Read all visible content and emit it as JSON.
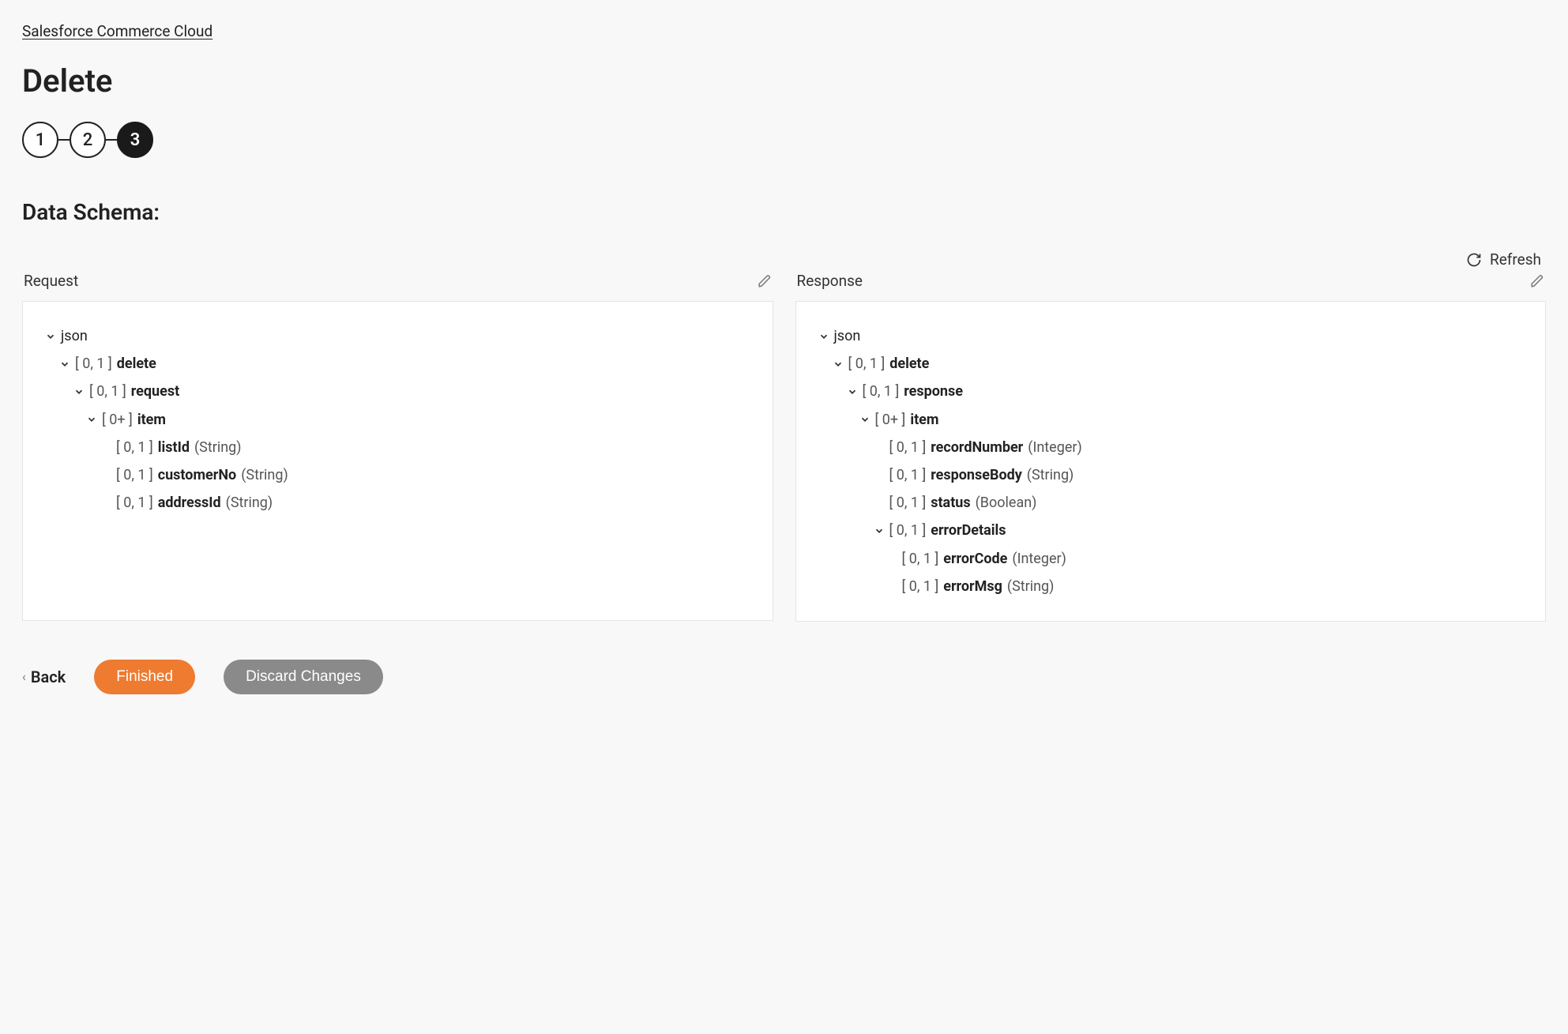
{
  "breadcrumb": "Salesforce Commerce Cloud",
  "page_title": "Delete",
  "stepper": {
    "steps": [
      "1",
      "2",
      "3"
    ],
    "active_index": 2
  },
  "section_title": "Data Schema:",
  "refresh_label": "Refresh",
  "columns": {
    "request": {
      "title": "Request",
      "tree": [
        {
          "indent": 0,
          "expandable": true,
          "text_plain": "json"
        },
        {
          "indent": 1,
          "expandable": true,
          "card": "[ 0, 1 ]",
          "name": "delete"
        },
        {
          "indent": 2,
          "expandable": true,
          "card": "[ 0, 1 ]",
          "name": "request"
        },
        {
          "indent": 3,
          "expandable": true,
          "card": "[ 0+ ]",
          "name": "item"
        },
        {
          "indent": 4,
          "expandable": false,
          "card": "[ 0, 1 ]",
          "name": "listId",
          "type": "(String)"
        },
        {
          "indent": 4,
          "expandable": false,
          "card": "[ 0, 1 ]",
          "name": "customerNo",
          "type": "(String)"
        },
        {
          "indent": 4,
          "expandable": false,
          "card": "[ 0, 1 ]",
          "name": "addressId",
          "type": "(String)"
        }
      ]
    },
    "response": {
      "title": "Response",
      "tree": [
        {
          "indent": 0,
          "expandable": true,
          "text_plain": "json"
        },
        {
          "indent": 1,
          "expandable": true,
          "card": "[ 0, 1 ]",
          "name": "delete"
        },
        {
          "indent": 2,
          "expandable": true,
          "card": "[ 0, 1 ]",
          "name": "response"
        },
        {
          "indent": 3,
          "expandable": true,
          "card": "[ 0+ ]",
          "name": "item"
        },
        {
          "indent": 4,
          "expandable": false,
          "card": "[ 0, 1 ]",
          "name": "recordNumber",
          "type": "(Integer)"
        },
        {
          "indent": 4,
          "expandable": false,
          "card": "[ 0, 1 ]",
          "name": "responseBody",
          "type": "(String)"
        },
        {
          "indent": 4,
          "expandable": false,
          "card": "[ 0, 1 ]",
          "name": "status",
          "type": "(Boolean)"
        },
        {
          "indent": 4,
          "expandable": true,
          "card": "[ 0, 1 ]",
          "name": "errorDetails"
        },
        {
          "indent": 5,
          "expandable": false,
          "card": "[ 0, 1 ]",
          "name": "errorCode",
          "type": "(Integer)"
        },
        {
          "indent": 5,
          "expandable": false,
          "card": "[ 0, 1 ]",
          "name": "errorMsg",
          "type": "(String)"
        }
      ]
    }
  },
  "footer": {
    "back": "Back",
    "finished": "Finished",
    "discard": "Discard Changes"
  }
}
